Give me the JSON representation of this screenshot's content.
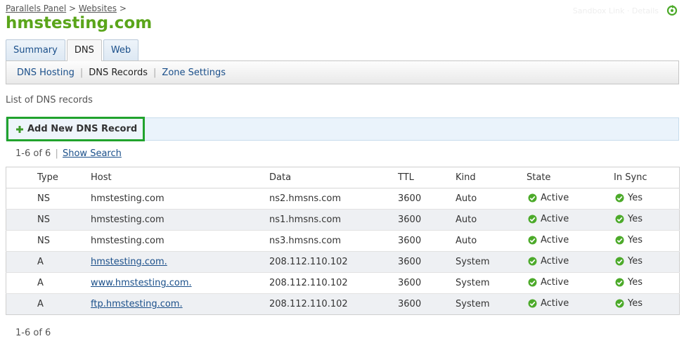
{
  "breadcrumb": {
    "items": [
      "Parallels Panel",
      "Websites"
    ],
    "separator": ">"
  },
  "header": {
    "faded_text": "Sandbox Link · Details"
  },
  "page": {
    "title": "hmstesting.com"
  },
  "tabs": [
    {
      "label": "Summary",
      "active": false
    },
    {
      "label": "DNS",
      "active": true
    },
    {
      "label": "Web",
      "active": false
    }
  ],
  "subnav": [
    {
      "label": "DNS Hosting",
      "current": false
    },
    {
      "label": "DNS Records",
      "current": true
    },
    {
      "label": "Zone Settings",
      "current": false
    }
  ],
  "list_caption": "List of DNS records",
  "toolbar": {
    "add_label": "Add New DNS Record",
    "add_icon": "plus-icon"
  },
  "pager": {
    "range": "1-6 of 6",
    "show_search": "Show Search"
  },
  "table": {
    "columns": [
      "Type",
      "Host",
      "Data",
      "TTL",
      "Kind",
      "State",
      "In Sync"
    ],
    "rows": [
      {
        "type": "NS",
        "host": "hmstesting.com",
        "host_link": false,
        "data": "ns2.hmsns.com",
        "ttl": "3600",
        "kind": "Auto",
        "state": "Active",
        "sync": "Yes"
      },
      {
        "type": "NS",
        "host": "hmstesting.com",
        "host_link": false,
        "data": "ns1.hmsns.com",
        "ttl": "3600",
        "kind": "Auto",
        "state": "Active",
        "sync": "Yes"
      },
      {
        "type": "NS",
        "host": "hmstesting.com",
        "host_link": false,
        "data": "ns3.hmsns.com",
        "ttl": "3600",
        "kind": "Auto",
        "state": "Active",
        "sync": "Yes"
      },
      {
        "type": "A",
        "host": "hmstesting.com.",
        "host_link": true,
        "data": "208.112.110.102",
        "ttl": "3600",
        "kind": "System",
        "state": "Active",
        "sync": "Yes"
      },
      {
        "type": "A",
        "host": "www.hmstesting.com.",
        "host_link": true,
        "data": "208.112.110.102",
        "ttl": "3600",
        "kind": "System",
        "state": "Active",
        "sync": "Yes"
      },
      {
        "type": "A",
        "host": "ftp.hmstesting.com.",
        "host_link": true,
        "data": "208.112.110.102",
        "ttl": "3600",
        "kind": "System",
        "state": "Active",
        "sync": "Yes"
      }
    ]
  },
  "colors": {
    "title_green": "#5aa51a",
    "highlight_border": "#21a32d",
    "link_blue": "#1a4f8a",
    "status_green": "#4caa2a"
  }
}
